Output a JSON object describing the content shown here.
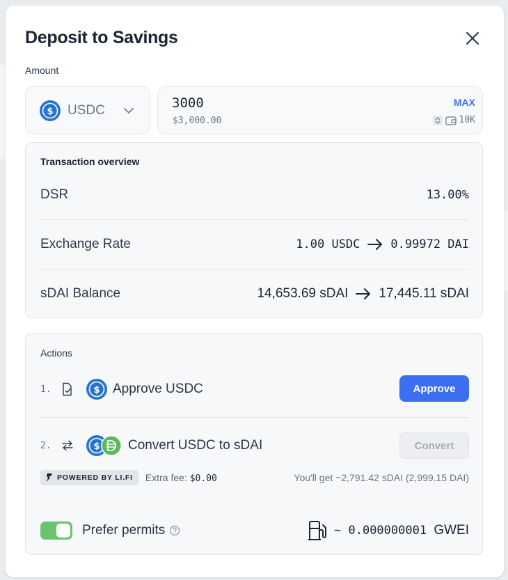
{
  "modal": {
    "title": "Deposit to Savings",
    "close_icon": "close-icon"
  },
  "amount": {
    "label": "Amount",
    "token": "USDC",
    "value": "3000",
    "usd_value": "$3,000.00",
    "max_label": "MAX",
    "balance": "10K"
  },
  "overview": {
    "title": "Transaction overview",
    "rows": [
      {
        "label": "DSR",
        "value": "13.00%"
      },
      {
        "label": "Exchange Rate",
        "from": "1.00 USDC",
        "to": "0.99972 DAI"
      },
      {
        "label": "sDAI Balance",
        "from": "14,653.69 sDAI",
        "to": "17,445.11 sDAI"
      }
    ]
  },
  "actions": {
    "title": "Actions",
    "steps": [
      {
        "number": "1.",
        "label": "Approve USDC",
        "button": "Approve",
        "icon": "document-check-icon"
      },
      {
        "number": "2.",
        "label": "Convert USDC to sDAI",
        "button": "Convert",
        "icon": "swap-arrows-icon"
      }
    ],
    "lifi": {
      "badge": "POWERED  BY LI.FI",
      "fee_label": "Extra fee:",
      "fee_value": "$0.00",
      "you_get": "You'll get ~2,791.42 sDAI (2,999.15 DAI)"
    },
    "permits": {
      "label": "Prefer permits",
      "enabled": true
    },
    "gas": {
      "value": "~ 0.000000001",
      "unit": "GWEI",
      "icon": "gas-pump-icon"
    }
  },
  "colors": {
    "primary": "#3b6ef0",
    "usdc": "#2775ca",
    "dai": "#5cb85c",
    "toggle_on": "#6cc36f"
  }
}
